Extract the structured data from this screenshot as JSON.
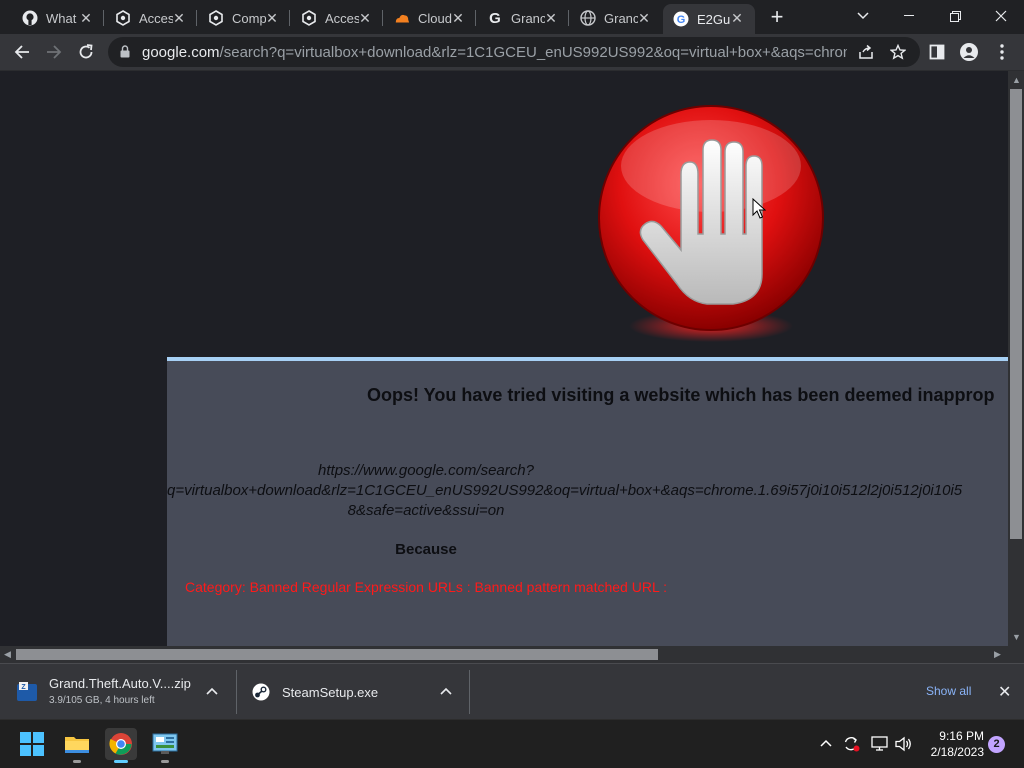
{
  "browser": {
    "tabs": [
      {
        "title": "What",
        "icon": "github-icon"
      },
      {
        "title": "Acces",
        "icon": "steam-icon"
      },
      {
        "title": "Comp",
        "icon": "steam-icon"
      },
      {
        "title": "Acces",
        "icon": "steam-icon"
      },
      {
        "title": "Cloud",
        "icon": "cloudflare-icon"
      },
      {
        "title": "Granc",
        "icon": "google-icon"
      },
      {
        "title": "Granc",
        "icon": "globe-icon"
      },
      {
        "title": "E2Gu",
        "icon": "google-icon",
        "active": true
      }
    ],
    "new_tab": "+",
    "url_host": "google.com",
    "url_rest": "/search?q=virtualbox+download&rlz=1C1GCEU_enUS992US992&oq=virtual+box+&aqs=chrome.1...."
  },
  "block_page": {
    "headline": "Oops! You have tried visiting a website which has been deemed inapprop",
    "url_line1": "https://www.google.com/search?",
    "url_line2": "q=virtualbox+download&rlz=1C1GCEU_enUS992US992&oq=virtual+box+&aqs=chrome.1.69i57j0i10i512l2j0i512j0i10i5",
    "url_line3": "8&safe=active&ssui=on",
    "because": "Because",
    "reason": "Category: Banned Regular Expression URLs : Banned pattern matched URL :"
  },
  "downloads": {
    "items": [
      {
        "name": "Grand.Theft.Auto.V....zip",
        "status": "3.9/105 GB, 4 hours left",
        "icon": "winzip-icon"
      },
      {
        "name": "SteamSetup.exe",
        "status": "",
        "icon": "steam-icon"
      }
    ],
    "show_all": "Show all",
    "close": "✕"
  },
  "taskbar": {
    "time": "9:16 PM",
    "date": "2/18/2023",
    "notifications": "2"
  }
}
